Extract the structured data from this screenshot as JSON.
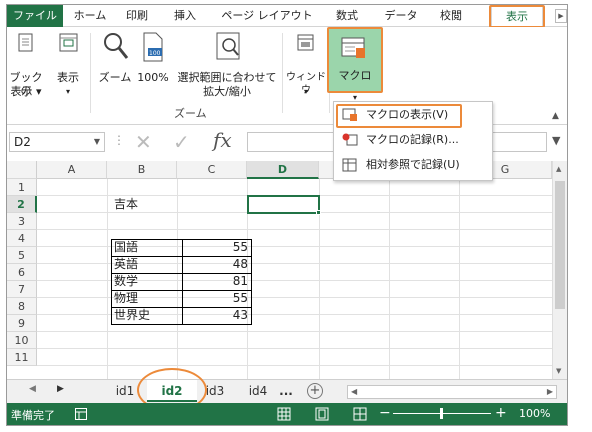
{
  "ribbon_tabs": [
    "ファイル",
    "ホーム",
    "印刷",
    "挿入",
    "ページ レイアウト",
    "数式",
    "データ",
    "校閲",
    "表示"
  ],
  "active_tab": "表示",
  "ribbon": {
    "book_view_label_1": "ブックの",
    "book_view_label_2": "表示 ▾",
    "show_label": "表示",
    "zoom_label": "ズーム",
    "zoom100_label": "100%",
    "zoom_selection_label_1": "選択範囲に合わせて",
    "zoom_selection_label_2": "拡大/縮小",
    "zoom_group_label": "ズーム",
    "window_label": "ウィンドウ",
    "macro_label": "マクロ",
    "icon_100": "100"
  },
  "macro_menu": {
    "items": [
      {
        "label": "マクロの表示(V)",
        "icon": "macro-view-icon"
      },
      {
        "label": "マクロの記録(R)...",
        "icon": "macro-record-icon"
      },
      {
        "label": "相対参照で記録(U)",
        "icon": "relative-reference-icon"
      }
    ]
  },
  "formula_bar": {
    "name_box": "D2",
    "fx": "fx",
    "cancel_symbol": "✕",
    "enter_symbol": "✓",
    "value": ""
  },
  "grid": {
    "columns": [
      "A",
      "B",
      "C",
      "D",
      "E",
      "F",
      "G"
    ],
    "rows": [
      "1",
      "2",
      "3",
      "4",
      "5",
      "6",
      "7",
      "8",
      "9",
      "10",
      "11"
    ],
    "selected_cell": "D2",
    "title_cell": "吉本",
    "table": [
      {
        "subject": "国語",
        "score": "55"
      },
      {
        "subject": "英語",
        "score": "48"
      },
      {
        "subject": "数学",
        "score": "81"
      },
      {
        "subject": "物理",
        "score": "55"
      },
      {
        "subject": "世界史",
        "score": "43"
      }
    ]
  },
  "sheet_tabs": [
    "id1",
    "id2",
    "id3",
    "id4"
  ],
  "active_sheet": "id2",
  "sheet_more": "...",
  "status_bar": {
    "ready": "準備完了",
    "zoom": "100%",
    "minus": "−",
    "plus": "+"
  },
  "colors": {
    "excel_green": "#217346",
    "highlight_orange": "#ec8a3a",
    "macro_button_bg": "#9bd5ab"
  }
}
